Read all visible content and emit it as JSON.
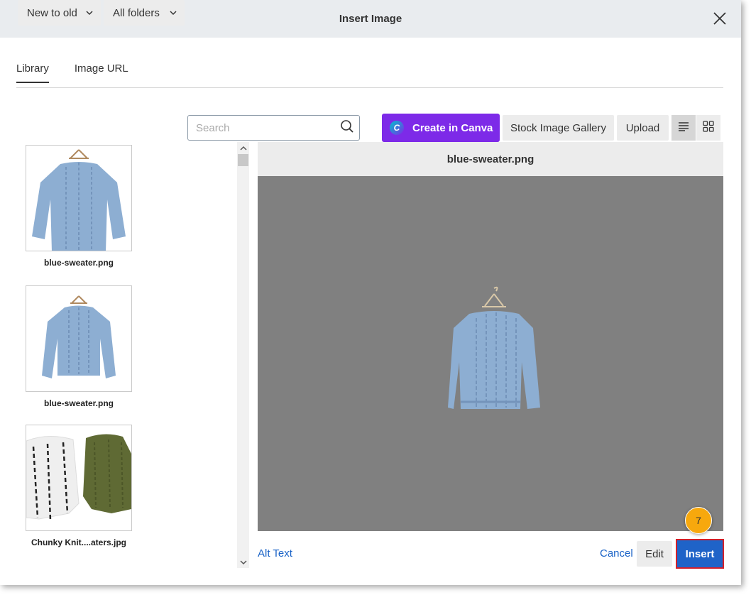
{
  "dialog": {
    "title": "Insert Image",
    "close_icon": "close-icon"
  },
  "tabs": [
    {
      "label": "Library",
      "active": true
    },
    {
      "label": "Image URL",
      "active": false
    }
  ],
  "toolbar": {
    "sort_value": "New to old",
    "folder_value": "All folders",
    "search_placeholder": "Search",
    "search_value": "",
    "canva_label": "Create in Canva",
    "stock_label": "Stock Image Gallery",
    "upload_label": "Upload",
    "view_list_icon": "list-view-icon",
    "view_grid_icon": "grid-view-icon"
  },
  "library": {
    "items": [
      {
        "name": "blue-sweater.png"
      },
      {
        "name": "blue-sweater.png"
      },
      {
        "name": "Chunky Knit....aters.jpg"
      }
    ]
  },
  "preview": {
    "filename": "blue-sweater.png"
  },
  "footer": {
    "alt_text": "Alt Text",
    "cancel": "Cancel",
    "edit": "Edit",
    "insert": "Insert",
    "step_number": "7"
  },
  "colors": {
    "canva_purple": "#7d2ae8",
    "insert_blue": "#1f63c8",
    "link_blue": "#1a63c7",
    "highlight_red": "#d3202a",
    "step_badge": "#f7a80d",
    "preview_bg": "#808080"
  }
}
